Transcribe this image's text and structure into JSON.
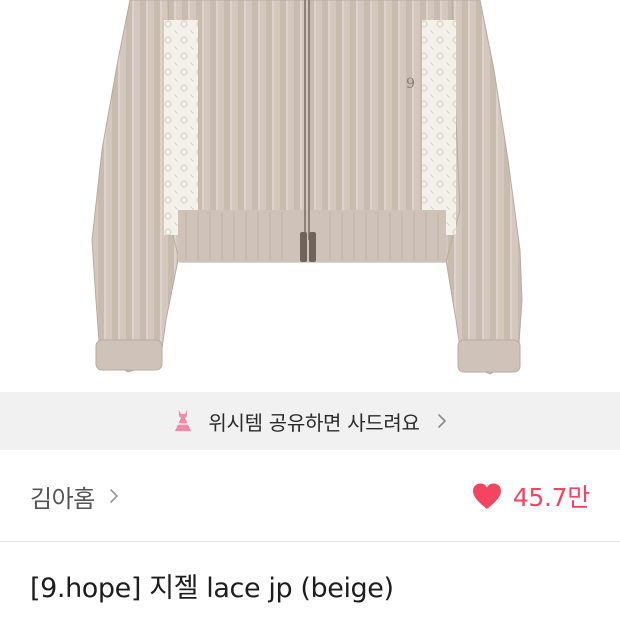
{
  "wish_banner": {
    "icon": "dress-icon",
    "text": "위시템 공유하면 사드려요",
    "chevron": "chevron-right-icon",
    "icon_color": "#f28aa4"
  },
  "seller": {
    "name": "김아홈",
    "chevron": "chevron-right-icon"
  },
  "likes": {
    "icon": "heart-icon",
    "count": "45.7만",
    "color": "#f5445f"
  },
  "product": {
    "title": "[9.hope] 지젤 lace jp (beige)",
    "image_subject": "beige ribbed zip-up jacket with lace side panels"
  }
}
